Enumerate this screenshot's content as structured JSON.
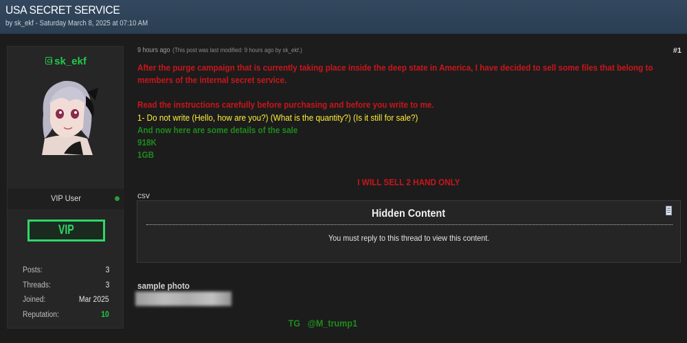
{
  "thread": {
    "title": "USA SECRET SERVICE",
    "meta": "by sk_ekf - Saturday March 8, 2025 at 07:10 AM"
  },
  "sidebar": {
    "username": "sk_ekf",
    "role": "VIP User",
    "badge": "VIP",
    "stats": [
      {
        "label": "Posts:",
        "value": "3"
      },
      {
        "label": "Threads:",
        "value": "3"
      },
      {
        "label": "Joined:",
        "value": "Mar 2025"
      },
      {
        "label": "Reputation:",
        "value": "10"
      }
    ]
  },
  "post": {
    "time": "9 hours ago",
    "modified": "(This post was last modified: 9 hours ago by sk_ekf.)",
    "number": "#1",
    "lines": {
      "l1": "After the purge campaign that is currently taking place inside the deep state in America, I have decided to sell some files that belong to",
      "l2": "members of the internal secret service.",
      "l3": "Read the instructions carefully before purchasing and before you write to me.",
      "l4": "1- Do not write (Hello, how are you?) (What is the quantity?) (Is it still for sale?)",
      "l5": "And now here are some details of the sale",
      "l6": "918K",
      "l7": "1GB"
    },
    "sell_note": "I WILL SELL 2 HAND ONLY",
    "csv_label": "csv",
    "hidden": {
      "title": "Hidden Content",
      "text": "You must reply to this thread to view this content."
    },
    "sample_label": "sample photo",
    "tg": "TG   @M_trump1"
  },
  "colors": {
    "red_text": "#c8161b",
    "yellow_text": "#ffee3b",
    "green_text": "#1f8a1c",
    "username_green": "#22c94a",
    "header_bg": "#2f4459"
  },
  "icons": [
    "user-status-icon",
    "spoiler-icon",
    "online-dot"
  ]
}
